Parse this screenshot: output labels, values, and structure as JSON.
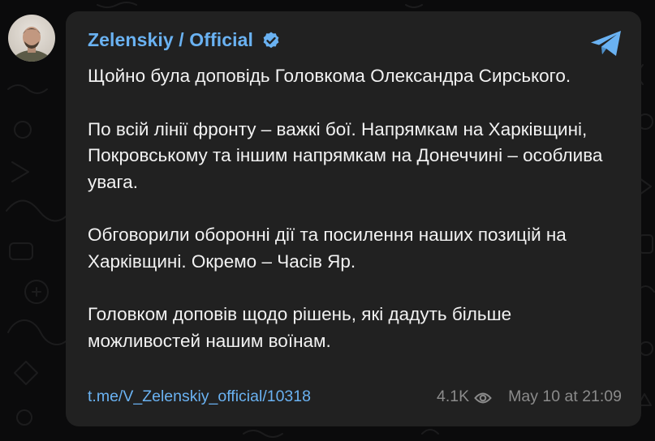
{
  "channel": {
    "name": "Zelenskiy / Official",
    "verified": true,
    "avatar": "avatar"
  },
  "message": {
    "paragraphs": [
      "Щойно була доповідь Головкома Олександра Сирського.",
      "По всій лінії фронту – важкі бої. Напрямкам на Харківщині, Покровському та іншим напрямкам на Донеччині – особлива увага.",
      "Обговорили оборонні дії та посилення наших позицій на Харківщині. Окремо – Часів Яр.",
      "Головком доповів щодо рішень, які дадуть більше можливостей нашим воїнам."
    ]
  },
  "footer": {
    "link": "t.me/V_Zelenskiy_official/10318",
    "views": "4.1K",
    "date": "May 10 at 21:09"
  },
  "icons": {
    "verified": "verified-badge-icon",
    "share": "telegram-share-icon",
    "views": "eye-icon"
  },
  "colors": {
    "accent": "#6ab2f2",
    "card_background": "#212121",
    "page_background": "#0b0b0c",
    "text": "#f2f2f2",
    "meta": "#8b8b8b"
  }
}
